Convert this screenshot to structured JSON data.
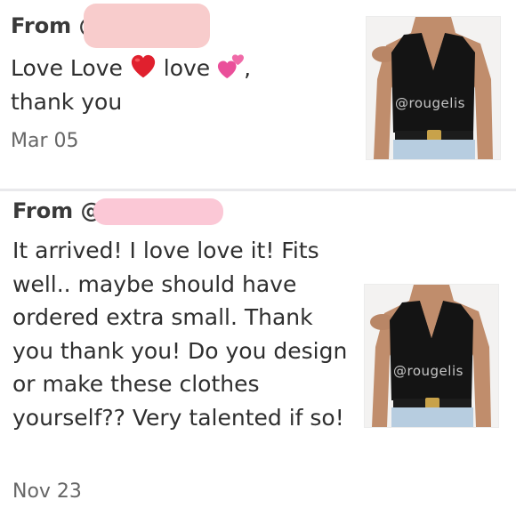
{
  "reviews": [
    {
      "from_prefix": "From @",
      "body_parts": [
        "Love Love ",
        " love ",
        ","
      ],
      "body_line2": "thank you",
      "date": "Mar 05",
      "thumb_watermark": "@rougelis"
    },
    {
      "from_prefix": "From @",
      "body": "It arrived! I love love it! Fits well.. maybe should have ordered extra small. Thank you thank you! Do you design or make these clothes yourself?? Very talented if so!",
      "date": "Nov 23",
      "thumb_watermark": "@rougelis"
    }
  ],
  "icons": {
    "red_heart": "red-heart-emoji",
    "two_hearts": "two-pink-hearts-emoji"
  },
  "colors": {
    "redaction_1": "#f8cccc",
    "redaction_2": "#fbc8d6",
    "heart_red": "#e0202e",
    "heart_pink": "#ea4f9a"
  }
}
